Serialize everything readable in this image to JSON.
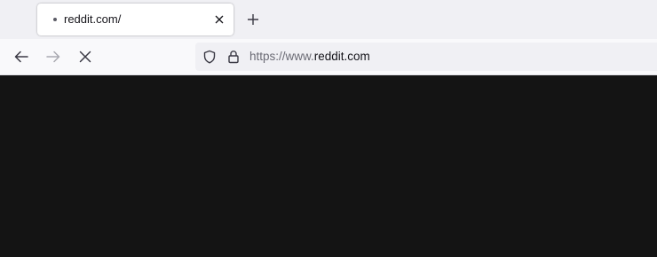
{
  "tabs": [
    {
      "title": "reddit.com/",
      "state": "loading"
    }
  ],
  "toolbar": {
    "back_icon": "arrow-left-icon",
    "forward_icon": "arrow-right-icon",
    "stop_icon": "close-icon",
    "new_tab_icon": "plus-icon"
  },
  "url_bar": {
    "scheme_prefix": "https://www.",
    "host": "reddit.com",
    "icons": [
      "shield-icon",
      "lock-icon"
    ]
  },
  "colors": {
    "tab_strip": "#f0f0f4",
    "nav_bar": "#f9f9fb",
    "url_field": "#f0f0f4",
    "page_background": "#141414"
  }
}
